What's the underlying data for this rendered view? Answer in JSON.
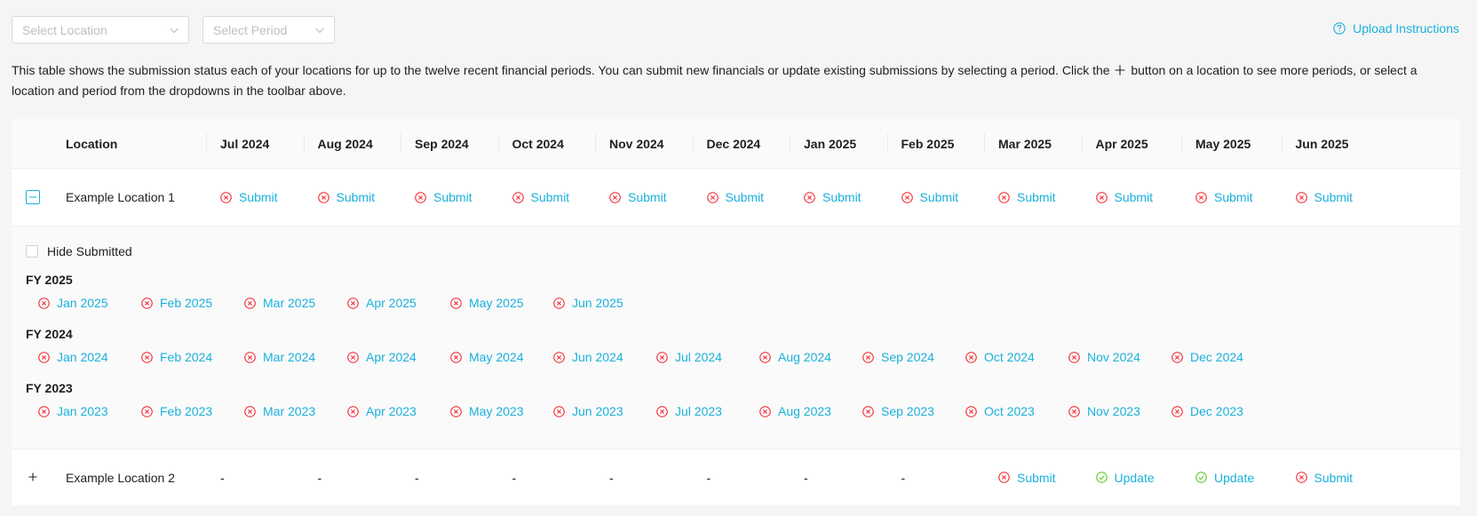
{
  "toolbar": {
    "location_placeholder": "Select Location",
    "period_placeholder": "Select Period",
    "upload_label": "Upload Instructions"
  },
  "description": {
    "before_icon": "This table shows the submission status each of your locations for up to the twelve recent financial periods. You can submit new financials or update existing submissions by selecting a period. Click the",
    "after_icon": "button on a location to see more periods, or select a location and period from the dropdowns in the toolbar above.",
    "icon": "plus-icon"
  },
  "table": {
    "location_header": "Location",
    "columns": [
      "Jul 2024",
      "Aug 2024",
      "Sep 2024",
      "Oct 2024",
      "Nov 2024",
      "Dec 2024",
      "Jan 2025",
      "Feb 2025",
      "Mar 2025",
      "Apr 2025",
      "May 2025",
      "Jun 2025"
    ],
    "rows": [
      {
        "name": "Example Location 1",
        "expanded": true,
        "cells": [
          {
            "status": "missing",
            "label": "Submit"
          },
          {
            "status": "missing",
            "label": "Submit"
          },
          {
            "status": "missing",
            "label": "Submit"
          },
          {
            "status": "missing",
            "label": "Submit"
          },
          {
            "status": "missing",
            "label": "Submit"
          },
          {
            "status": "missing",
            "label": "Submit"
          },
          {
            "status": "missing",
            "label": "Submit"
          },
          {
            "status": "missing",
            "label": "Submit"
          },
          {
            "status": "missing",
            "label": "Submit"
          },
          {
            "status": "missing",
            "label": "Submit"
          },
          {
            "status": "missing",
            "label": "Submit"
          },
          {
            "status": "missing",
            "label": "Submit"
          }
        ]
      },
      {
        "name": "Example Location 2",
        "expanded": false,
        "cells": [
          {
            "status": "none",
            "label": "-"
          },
          {
            "status": "none",
            "label": "-"
          },
          {
            "status": "none",
            "label": "-"
          },
          {
            "status": "none",
            "label": "-"
          },
          {
            "status": "none",
            "label": "-"
          },
          {
            "status": "none",
            "label": "-"
          },
          {
            "status": "none",
            "label": "-"
          },
          {
            "status": "none",
            "label": "-"
          },
          {
            "status": "missing",
            "label": "Submit"
          },
          {
            "status": "done",
            "label": "Update"
          },
          {
            "status": "done",
            "label": "Update"
          },
          {
            "status": "missing",
            "label": "Submit"
          }
        ]
      }
    ]
  },
  "expanded_panel": {
    "hide_submitted_label": "Hide Submitted",
    "hide_submitted_checked": false,
    "fiscal_years": [
      {
        "title": "FY 2025",
        "periods": [
          "Jan 2025",
          "Feb 2025",
          "Mar 2025",
          "Apr 2025",
          "May 2025",
          "Jun 2025"
        ]
      },
      {
        "title": "FY 2024",
        "periods": [
          "Jan 2024",
          "Feb 2024",
          "Mar 2024",
          "Apr 2024",
          "May 2024",
          "Jun 2024",
          "Jul 2024",
          "Aug 2024",
          "Sep 2024",
          "Oct 2024",
          "Nov 2024",
          "Dec 2024"
        ]
      },
      {
        "title": "FY 2023",
        "periods": [
          "Jan 2023",
          "Feb 2023",
          "Mar 2023",
          "Apr 2023",
          "May 2023",
          "Jun 2023",
          "Jul 2023",
          "Aug 2023",
          "Sep 2023",
          "Oct 2023",
          "Nov 2023",
          "Dec 2023"
        ]
      }
    ]
  },
  "colors": {
    "accent": "#1ab0dc",
    "missing": "#f5222d",
    "done": "#52c41a"
  }
}
